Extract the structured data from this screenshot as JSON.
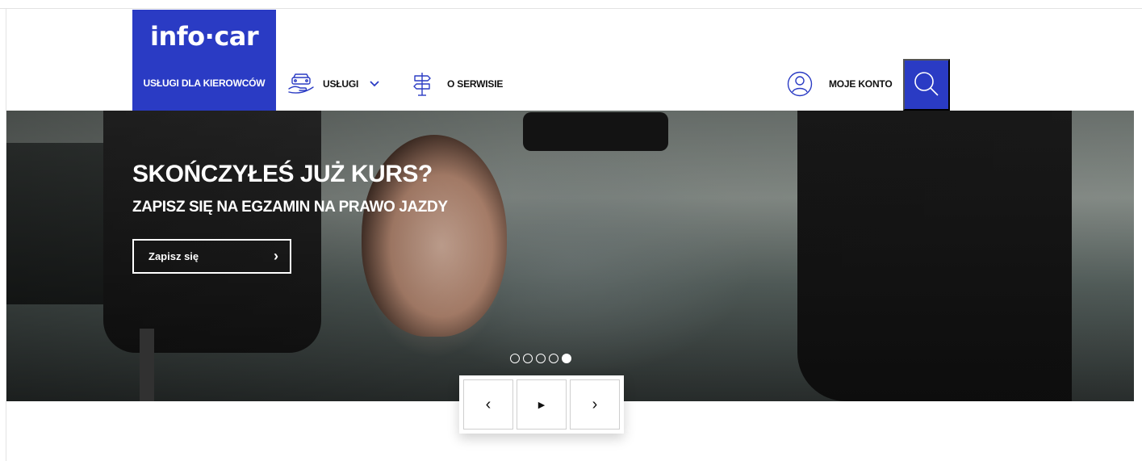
{
  "header": {
    "logo_text": "info·car",
    "brand_tab": "USŁUGI DLA KIEROWCÓW",
    "nav": {
      "uslugi": "USŁUGI",
      "o_serwisie": "O SERWISIE",
      "moje_konto": "MOJE KONTO"
    }
  },
  "hero": {
    "title": "SKOŃCZYŁEŚ JUŻ KURS?",
    "subtitle": "ZAPISZ SIĘ NA EGZAMIN NA PRAWO JAZDY",
    "cta_label": "Zapisz się",
    "cta_arrow": "›",
    "slide_count": 5,
    "active_slide": 5
  },
  "controls": {
    "prev": "‹",
    "play": "▶",
    "next": "›"
  },
  "colors": {
    "brand_blue": "#2a3bc4",
    "text_dark": "#111111"
  },
  "icons": {
    "uslugi": "car-hand-icon",
    "o_serwisie": "signpost-icon",
    "moje_konto": "user-icon",
    "search": "search-icon",
    "dropdown": "chevron-down-icon"
  }
}
